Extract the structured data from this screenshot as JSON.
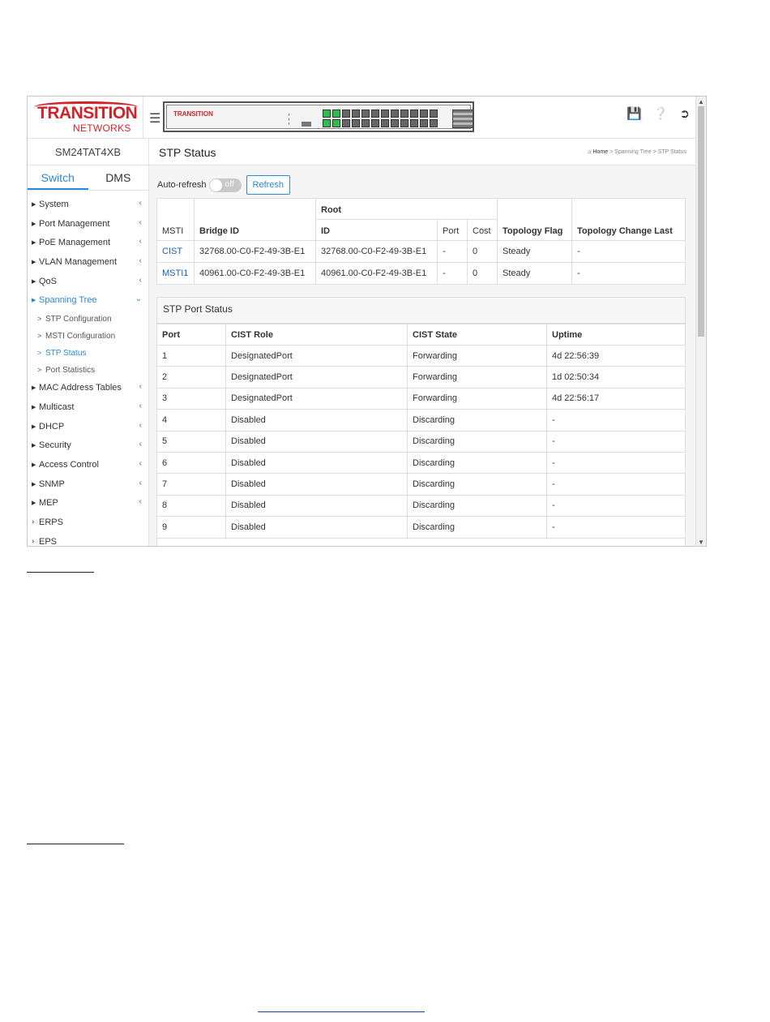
{
  "device": {
    "logo_main": "TRANSITION",
    "logo_sub": "NETWORKS",
    "panel_logo": "TRANSITION",
    "model": "SM24TAT4XB"
  },
  "sidebar": {
    "tabs": [
      {
        "label": "Switch",
        "active": true
      },
      {
        "label": "DMS",
        "active": false
      }
    ],
    "items": [
      {
        "label": "System"
      },
      {
        "label": "Port Management"
      },
      {
        "label": "PoE Management"
      },
      {
        "label": "VLAN Management"
      },
      {
        "label": "QoS"
      },
      {
        "label": "Spanning Tree"
      },
      {
        "label": "MAC Address Tables"
      },
      {
        "label": "Multicast"
      },
      {
        "label": "DHCP"
      },
      {
        "label": "Security"
      },
      {
        "label": "Access Control"
      },
      {
        "label": "SNMP"
      },
      {
        "label": "MEP"
      },
      {
        "label": "ERPS"
      },
      {
        "label": "EPS"
      }
    ],
    "sub_items": [
      {
        "label": "STP Configuration"
      },
      {
        "label": "MSTI Configuration"
      },
      {
        "label": "STP Status"
      },
      {
        "label": "Port Statistics"
      }
    ]
  },
  "header": {
    "title": "STP Status",
    "breadcrumb": [
      "Home",
      "Spanning Tree",
      "STP Status"
    ],
    "icons": [
      "save-icon",
      "help-icon",
      "logout-icon"
    ]
  },
  "controls": {
    "auto_refresh_label": "Auto-refresh",
    "toggle_state": "off",
    "refresh_label": "Refresh"
  },
  "stp_table": {
    "root_group": "Root",
    "headers": [
      "MSTI",
      "Bridge ID",
      "ID",
      "Port",
      "Cost",
      "Topology Flag",
      "Topology Change Last"
    ],
    "rows": [
      [
        "CIST",
        "32768.00-C0-F2-49-3B-E1",
        "32768.00-C0-F2-49-3B-E1",
        "-",
        "0",
        "Steady",
        "-"
      ],
      [
        "MSTI1",
        "40961.00-C0-F2-49-3B-E1",
        "40961.00-C0-F2-49-3B-E1",
        "-",
        "0",
        "Steady",
        "-"
      ]
    ]
  },
  "port_status": {
    "title": "STP Port Status",
    "headers": [
      "Port",
      "CIST Role",
      "CIST State",
      "Uptime"
    ],
    "rows": [
      [
        "1",
        "DesignatedPort",
        "Forwarding",
        "4d 22:56:39"
      ],
      [
        "2",
        "DesignatedPort",
        "Forwarding",
        "1d 02:50:34"
      ],
      [
        "3",
        "DesignatedPort",
        "Forwarding",
        "4d 22:56:17"
      ],
      [
        "4",
        "Disabled",
        "Discarding",
        "-"
      ],
      [
        "5",
        "Disabled",
        "Discarding",
        "-"
      ],
      [
        "6",
        "Disabled",
        "Discarding",
        "-"
      ],
      [
        "7",
        "Disabled",
        "Discarding",
        "-"
      ],
      [
        "8",
        "Disabled",
        "Discarding",
        "-"
      ],
      [
        "9",
        "Disabled",
        "Discarding",
        "-"
      ]
    ]
  },
  "colors": {
    "accent": "#2a8ad6",
    "brand": "#d2232a",
    "port_up": "#2ebd4c"
  }
}
